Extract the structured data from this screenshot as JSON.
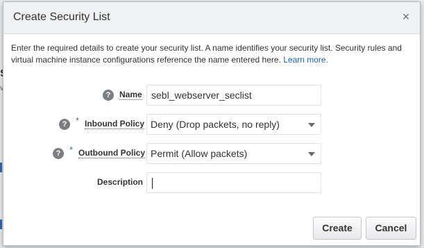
{
  "dialog": {
    "title": "Create Security List",
    "close_glyph": "×",
    "intro_text": "Enter the required details to create your security list. A name identifies your security list. Security rules and virtual machine instance configurations reference the name entered here. ",
    "learn_more": "Learn more."
  },
  "background": {
    "fragment_s": "s",
    "fragment_v": "v"
  },
  "form": {
    "name": {
      "label": "Name",
      "value": "sebl_webserver_seclist"
    },
    "inbound_policy": {
      "label": "Inbound Policy",
      "required_mark": "*",
      "selected": "Deny (Drop packets, no reply)"
    },
    "outbound_policy": {
      "label": "Outbound Policy",
      "required_mark": "*",
      "selected": "Permit (Allow packets)"
    },
    "description": {
      "label": "Description",
      "value": ""
    },
    "help_glyph": "?"
  },
  "buttons": {
    "create": "Create",
    "cancel": "Cancel"
  },
  "icons": {
    "help": "question-circle-icon",
    "close": "close-icon",
    "dropdown": "chevron-down-icon"
  }
}
